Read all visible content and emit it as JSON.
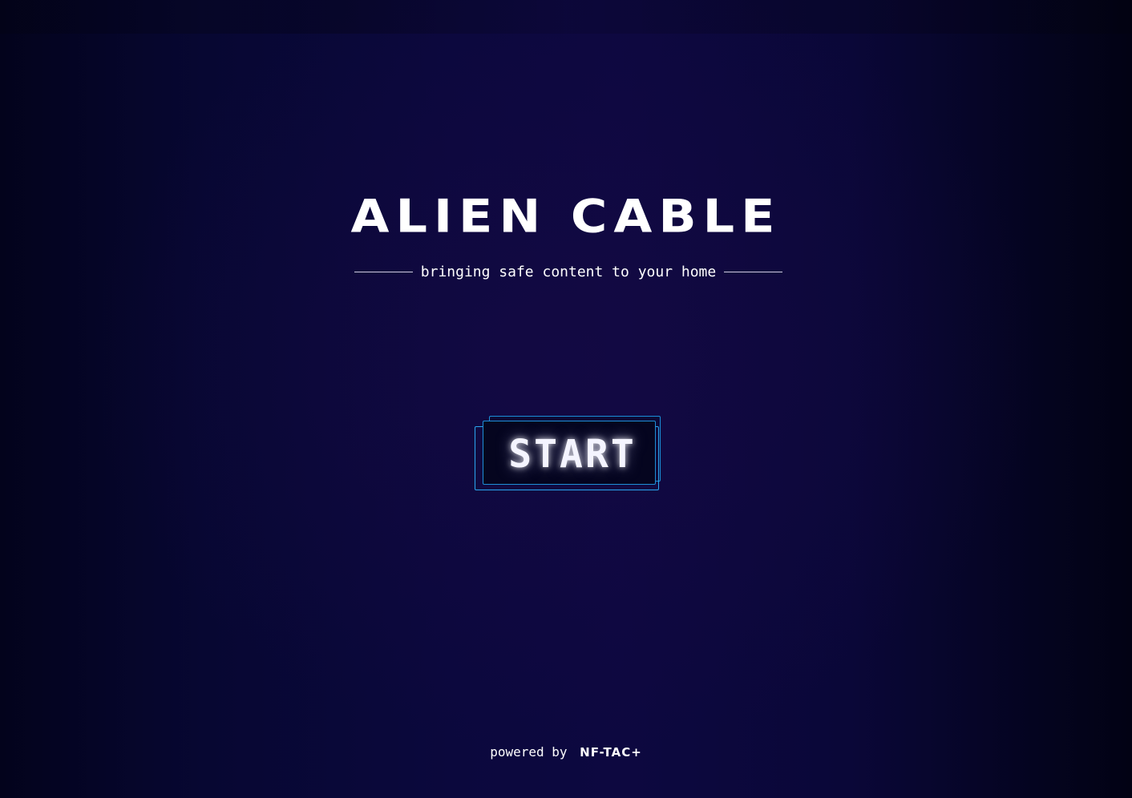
{
  "title": "ALIEN CABLE",
  "tagline": "bringing safe content to your home",
  "start_label": "START",
  "footer": {
    "prefix": "powered by",
    "brand": "NF-TAC+"
  },
  "colors": {
    "background": "#0b083d",
    "button_border": "#2aa7ef",
    "text": "#ffffff"
  }
}
